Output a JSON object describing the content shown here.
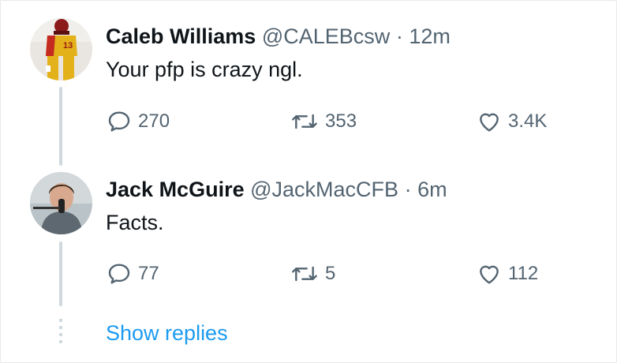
{
  "tweets": [
    {
      "name": "Caleb Williams",
      "handle": "@CALEBcsw",
      "separator": "·",
      "time": "12m",
      "text": "Your pfp is crazy ngl.",
      "replies": "270",
      "retweets": "353",
      "likes": "3.4K",
      "avatar_jersey_number": "13"
    },
    {
      "name": "Jack McGuire",
      "handle": "@JackMacCFB",
      "separator": "·",
      "time": "6m",
      "text": "Facts.",
      "replies": "77",
      "retweets": "5",
      "likes": "112"
    }
  ],
  "show_replies": "Show replies",
  "colors": {
    "accent": "#1d9bf0",
    "secondary_text": "#536471",
    "thread_line": "#cfd9de"
  }
}
